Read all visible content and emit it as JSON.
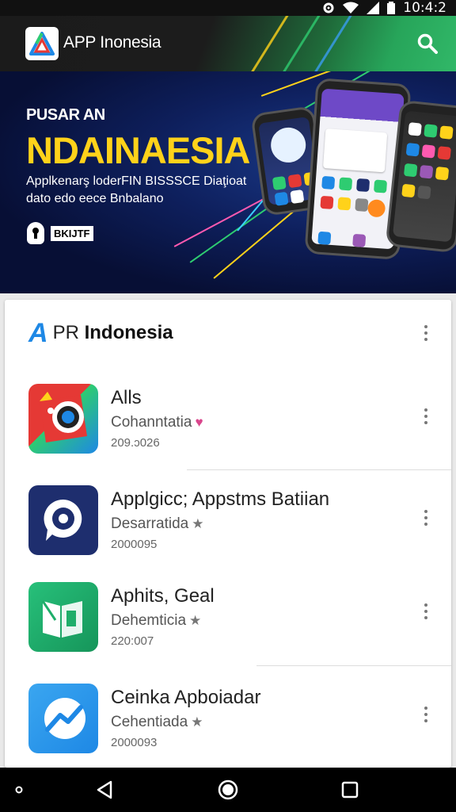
{
  "status_bar": {
    "time": "10:4:2",
    "icons": [
      "settings-icon",
      "wifi-icon",
      "signal-icon",
      "battery-icon"
    ]
  },
  "app_bar": {
    "title": "APP Inonesia",
    "logo_icon": "triangle-logo-icon",
    "search_icon": "search-icon"
  },
  "banner": {
    "kicker": "PUSAR AN",
    "title": "NDAINAESIA",
    "subtitle_line1": "Applkenarş loderFIN BISSSCE Diaţioat",
    "subtitle_line2": "dato edo eece Bnbalano",
    "badge_label": "BKIJTF"
  },
  "card": {
    "brand_logo": "A",
    "title_prefix": "PR",
    "title_bold": "Indonesia"
  },
  "apps": [
    {
      "name": "Alls",
      "developer": "Cohanntatia",
      "mark": "♥",
      "mark_color": "#d9458c",
      "date": "209.ɔ026",
      "icon": "camera-app-icon",
      "icon_bg": "#e53935"
    },
    {
      "name": "Applgicc; Appstms Batiian",
      "developer": "Desarratida",
      "mark": "★",
      "mark_color": "#777777",
      "date": "2000095",
      "icon": "chat-bubble-app-icon",
      "icon_bg": "#1e2e6e"
    },
    {
      "name": "Aphits, Geal",
      "developer": "Dehemticia",
      "mark": "★",
      "mark_color": "#777777",
      "date": "220:007",
      "icon": "map-app-icon",
      "icon_bg": "#1fae6a"
    },
    {
      "name": "Ceinka Apboiadar",
      "developer": "Cehentiada",
      "mark": "★",
      "mark_color": "#777777",
      "date": "2000093",
      "icon": "trend-chart-app-icon",
      "icon_bg": "#1e8fe8"
    }
  ],
  "nav": {
    "back": "back-icon",
    "home": "home-icon",
    "recents": "recents-icon",
    "dot": "dot-icon"
  },
  "colors": {
    "accent_yellow": "#ffd21a",
    "brand_blue": "#1e88e5",
    "green": "#27a55a"
  }
}
